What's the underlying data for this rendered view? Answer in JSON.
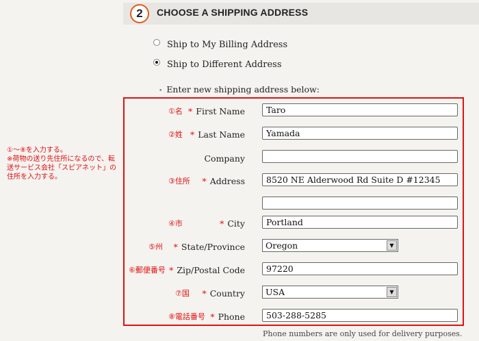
{
  "section": {
    "step_number": "2",
    "title": "CHOOSE A SHIPPING ADDRESS"
  },
  "shipping_options": [
    {
      "label": "Ship to My Billing Address",
      "selected": false
    },
    {
      "label": "Ship to Different Address",
      "selected": true
    }
  ],
  "intro_text": "Enter new shipping address below:",
  "fields": {
    "first_name": {
      "jp_note": "①名",
      "label": "First Name",
      "value": "Taro"
    },
    "last_name": {
      "jp_note": "②姓",
      "label": "Last Name",
      "value": "Yamada"
    },
    "company": {
      "label": "Company",
      "value": ""
    },
    "address": {
      "jp_note": "③住所",
      "label": "Address",
      "value": "8520 NE Alderwood Rd Suite D #12345"
    },
    "address2": {
      "value": ""
    },
    "city": {
      "jp_note": "④市",
      "label": "City",
      "value": "Portland"
    },
    "state": {
      "jp_note": "⑤州",
      "label": "State/Province",
      "value": "Oregon"
    },
    "zip": {
      "jp_note": "⑥郵便番号",
      "label": "Zip/Postal Code",
      "value": "97220"
    },
    "country": {
      "jp_note": "⑦国",
      "label": "Country",
      "value": "USA"
    },
    "phone": {
      "jp_note": "⑧電話番号",
      "label": "Phone",
      "value": "503-288-5285"
    }
  },
  "required_marker": "*",
  "phone_note": "Phone numbers are only used for delivery purposes.",
  "side_annotation": "①～⑧を入力する。\n※荷物の送り先住所になるので、転送サービス会社「スピアネット」の住所を入力する。",
  "colors": {
    "accent_orange": "#e25b1c",
    "annotation_red": "#e01010"
  }
}
